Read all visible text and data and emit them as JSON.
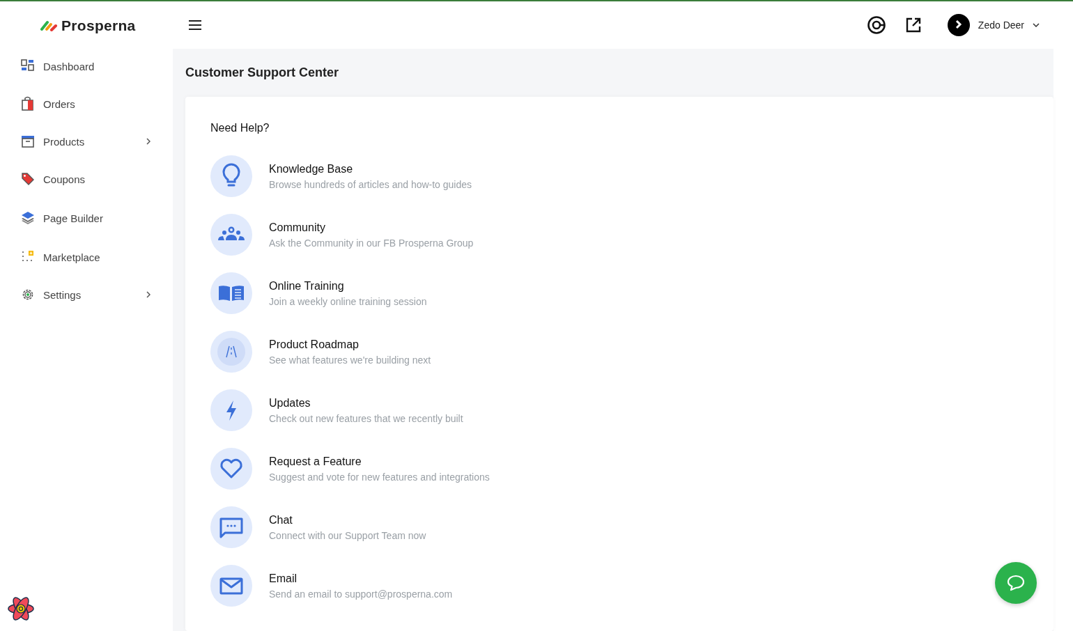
{
  "brand": {
    "name": "Prosperna"
  },
  "sidebar": {
    "items": [
      {
        "label": "Dashboard",
        "kind": "dashboard",
        "has_submenu": false
      },
      {
        "label": "Orders",
        "kind": "orders",
        "has_submenu": false
      },
      {
        "label": "Products",
        "kind": "products",
        "has_submenu": true
      },
      {
        "label": "Coupons",
        "kind": "coupons",
        "has_submenu": false
      },
      {
        "label": "Page Builder",
        "kind": "layers",
        "has_submenu": false
      },
      {
        "label": "Marketplace",
        "kind": "marketplace",
        "has_submenu": false
      },
      {
        "label": "Settings",
        "kind": "settings",
        "has_submenu": true
      }
    ]
  },
  "header": {
    "user": {
      "name": "Zedo Deer"
    }
  },
  "page": {
    "title": "Customer Support Center"
  },
  "help": {
    "heading": "Need Help?",
    "items": [
      {
        "kind": "bulb",
        "title": "Knowledge Base",
        "description": "Browse hundreds of articles and how-to guides"
      },
      {
        "kind": "people",
        "title": "Community",
        "description": "Ask the Community in our FB Prosperna Group"
      },
      {
        "kind": "book",
        "title": "Online Training",
        "description": "Join a weekly online training session"
      },
      {
        "kind": "road",
        "title": "Product Roadmap",
        "description": "See what features we're building next"
      },
      {
        "kind": "bolt",
        "title": "Updates",
        "description": "Check out new features that we recently built"
      },
      {
        "kind": "heart",
        "title": "Request a Feature",
        "description": "Suggest and vote for new features and integrations"
      },
      {
        "kind": "chat",
        "title": "Chat",
        "description": "Connect with our Support Team now"
      },
      {
        "kind": "mail",
        "title": "Email",
        "description": "Send an email to support@prosperna.com"
      }
    ]
  }
}
